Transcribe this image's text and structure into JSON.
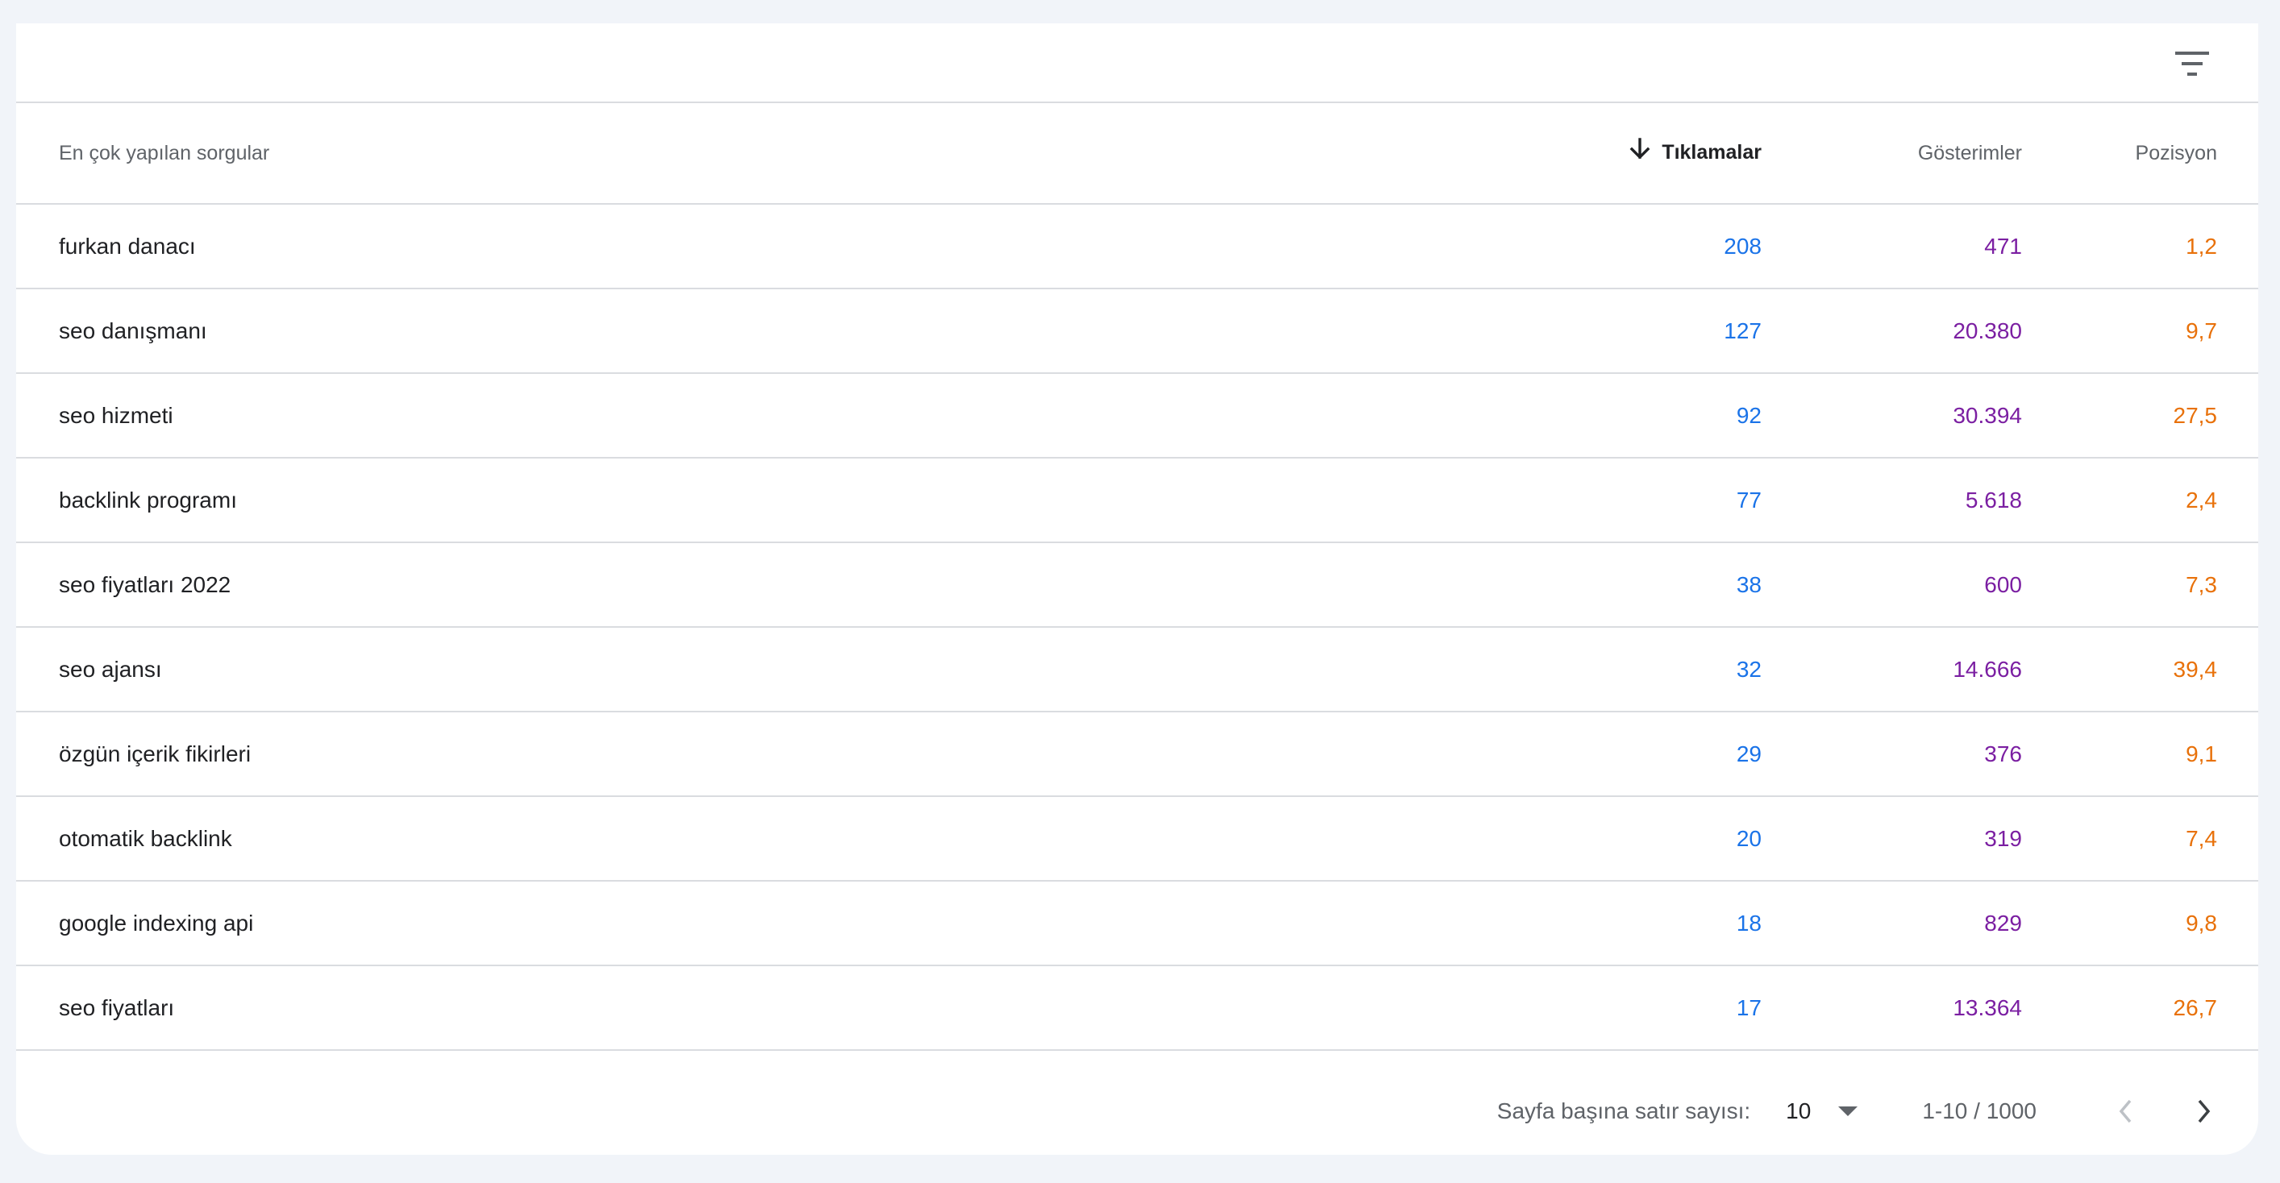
{
  "table": {
    "headers": {
      "query": "En çok yapılan sorgular",
      "clicks": "Tıklamalar",
      "impressions": "Gösterimler",
      "position": "Pozisyon"
    },
    "sorted_by": "clicks",
    "sort_direction": "descending",
    "rows": [
      {
        "query": "furkan danacı",
        "clicks": "208",
        "impressions": "471",
        "position": "1,2"
      },
      {
        "query": "seo danışmanı",
        "clicks": "127",
        "impressions": "20.380",
        "position": "9,7"
      },
      {
        "query": "seo hizmeti",
        "clicks": "92",
        "impressions": "30.394",
        "position": "27,5"
      },
      {
        "query": "backlink programı",
        "clicks": "77",
        "impressions": "5.618",
        "position": "2,4"
      },
      {
        "query": "seo fiyatları 2022",
        "clicks": "38",
        "impressions": "600",
        "position": "7,3"
      },
      {
        "query": "seo ajansı",
        "clicks": "32",
        "impressions": "14.666",
        "position": "39,4"
      },
      {
        "query": "özgün içerik fikirleri",
        "clicks": "29",
        "impressions": "376",
        "position": "9,1"
      },
      {
        "query": "otomatik backlink",
        "clicks": "20",
        "impressions": "319",
        "position": "7,4"
      },
      {
        "query": "google indexing api",
        "clicks": "18",
        "impressions": "829",
        "position": "9,8"
      },
      {
        "query": "seo fiyatları",
        "clicks": "17",
        "impressions": "13.364",
        "position": "26,7"
      }
    ]
  },
  "pagination": {
    "rows_per_page_label": "Sayfa başına satır sayısı:",
    "rows_per_page_value": "10",
    "range_text": "1-10 / 1000"
  },
  "icons": {
    "filter": "filter-icon",
    "sort": "arrow-down-icon",
    "dropdown": "dropdown-triangle-icon",
    "prev": "chevron-left-icon",
    "next": "chevron-right-icon"
  },
  "colors": {
    "clicks": "#1a73e8",
    "impressions": "#7b1fa2",
    "position": "#e8710a",
    "background": "#f1f4f9"
  }
}
